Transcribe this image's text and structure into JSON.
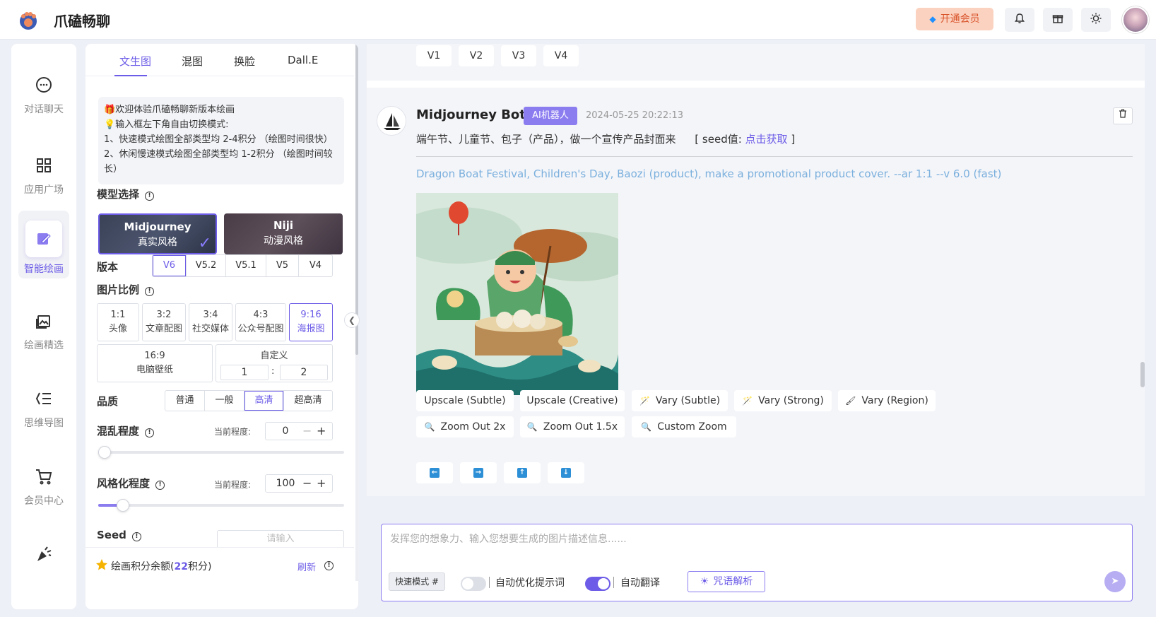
{
  "app": {
    "name": "爪磕畅聊"
  },
  "header": {
    "vip_label": "开通会员"
  },
  "nav": [
    {
      "label": "对话聊天",
      "icon": "chat-bubble-icon"
    },
    {
      "label": "应用广场",
      "icon": "grid-icon"
    },
    {
      "label": "智能绘画",
      "icon": "paint-brush-icon",
      "active": true
    },
    {
      "label": "绘画精选",
      "icon": "image-gallery-icon"
    },
    {
      "label": "思维导图",
      "icon": "mind-map-icon"
    },
    {
      "label": "会员中心",
      "icon": "cart-icon"
    },
    {
      "label": "",
      "icon": "party-popper-icon"
    }
  ],
  "panel": {
    "tabs": [
      "文生图",
      "混图",
      "换脸",
      "Dall.E"
    ],
    "active_tab": "文生图",
    "notice": [
      "🎁欢迎体验爪磕畅聊新版本绘画",
      "💡输入框左下角自由切换模式:",
      "1、快速模式绘图全部类型均 2-4积分 （绘图时间很快）",
      "2、休闲慢速模式绘图全部类型均 1-2积分 （绘图时间较长）"
    ],
    "model_title": "模型选择",
    "models": [
      {
        "name": "Midjourney",
        "sub": "真实风格",
        "selected": true
      },
      {
        "name": "Niji",
        "sub": "动漫风格",
        "selected": false
      }
    ],
    "version_title": "版本",
    "versions": [
      "V6",
      "V5.2",
      "V5.1",
      "V5",
      "V4"
    ],
    "version_selected": "V6",
    "ratio_title": "图片比例",
    "ratios": [
      {
        "value": "1:1",
        "label": "头像"
      },
      {
        "value": "3:2",
        "label": "文章配图"
      },
      {
        "value": "3:4",
        "label": "社交媒体"
      },
      {
        "value": "4:3",
        "label": "公众号配图"
      },
      {
        "value": "9:16",
        "label": "海报图",
        "selected": true
      }
    ],
    "ratio_wide": {
      "value": "16:9",
      "label": "电脑壁纸"
    },
    "ratio_custom": {
      "label": "自定义",
      "w": "1",
      "sep": ":",
      "h": "2"
    },
    "quality_title": "品质",
    "qualities": [
      "普通",
      "一般",
      "高清",
      "超高清"
    ],
    "quality_selected": "高清",
    "chaos_title": "混乱程度",
    "chaos_current_label": "当前程度:",
    "chaos_value": "0",
    "chaos_fraction": 0.02,
    "stylize_title": "风格化程度",
    "stylize_current_label": "当前程度:",
    "stylize_value": "100",
    "stylize_fraction": 0.1,
    "seed_title": "Seed",
    "seed_placeholder": "请输入",
    "credits_prefix": "绘画积分余额(",
    "credits_value": "22",
    "credits_suffix": "积分)",
    "refresh_label": "刷新"
  },
  "chat": {
    "v_buttons": [
      "V1",
      "V2",
      "V3",
      "V4"
    ],
    "bot_name": "Midjourney Bot",
    "bot_badge": "AI机器人",
    "timestamp": "2024-05-25 20:22:13",
    "prompt": "端午节、儿童节、包子（产品），做一个宣传产品封面来",
    "seed_prefix": "[ seed值:",
    "seed_link": "点击获取",
    "seed_suffix": "]",
    "en_prompt": "Dragon Boat Festival, Children's Day, Baozi (product), make a promotional product cover. --ar 1:1 --v 6.0  (fast)",
    "actions_row1": [
      {
        "label": "Upscale (Subtle)",
        "icon": ""
      },
      {
        "label": "Upscale (Creative)",
        "icon": ""
      },
      {
        "label": "Vary (Subtle)",
        "icon": "magic-wand-icon"
      },
      {
        "label": "Vary (Strong)",
        "icon": "magic-wand-icon"
      },
      {
        "label": "Vary (Region)",
        "icon": "brush-icon"
      }
    ],
    "actions_row2": [
      {
        "label": "Zoom Out 2x",
        "icon": "magnifier-icon"
      },
      {
        "label": "Zoom Out 1.5x",
        "icon": "magnifier-icon"
      },
      {
        "label": "Custom Zoom",
        "icon": "magnifier-icon"
      }
    ],
    "pan_buttons": [
      "arrow-left-icon",
      "arrow-right-icon",
      "arrow-up-icon",
      "arrow-down-icon"
    ]
  },
  "input": {
    "placeholder": "发挥您的想象力、输入您想要生成的图片描述信息......",
    "mode_chip": "快速模式 #",
    "auto_optimize_label": "自动优化提示词",
    "auto_optimize_on": false,
    "auto_translate_label": "自动翻译",
    "auto_translate_on": true,
    "spell_label": "咒语解析"
  },
  "colors": {
    "accent": "#6c5ce7",
    "vip_bg": "#fbd2c0",
    "vip_text": "#d9542b",
    "en_prompt": "#7bb0dd"
  }
}
